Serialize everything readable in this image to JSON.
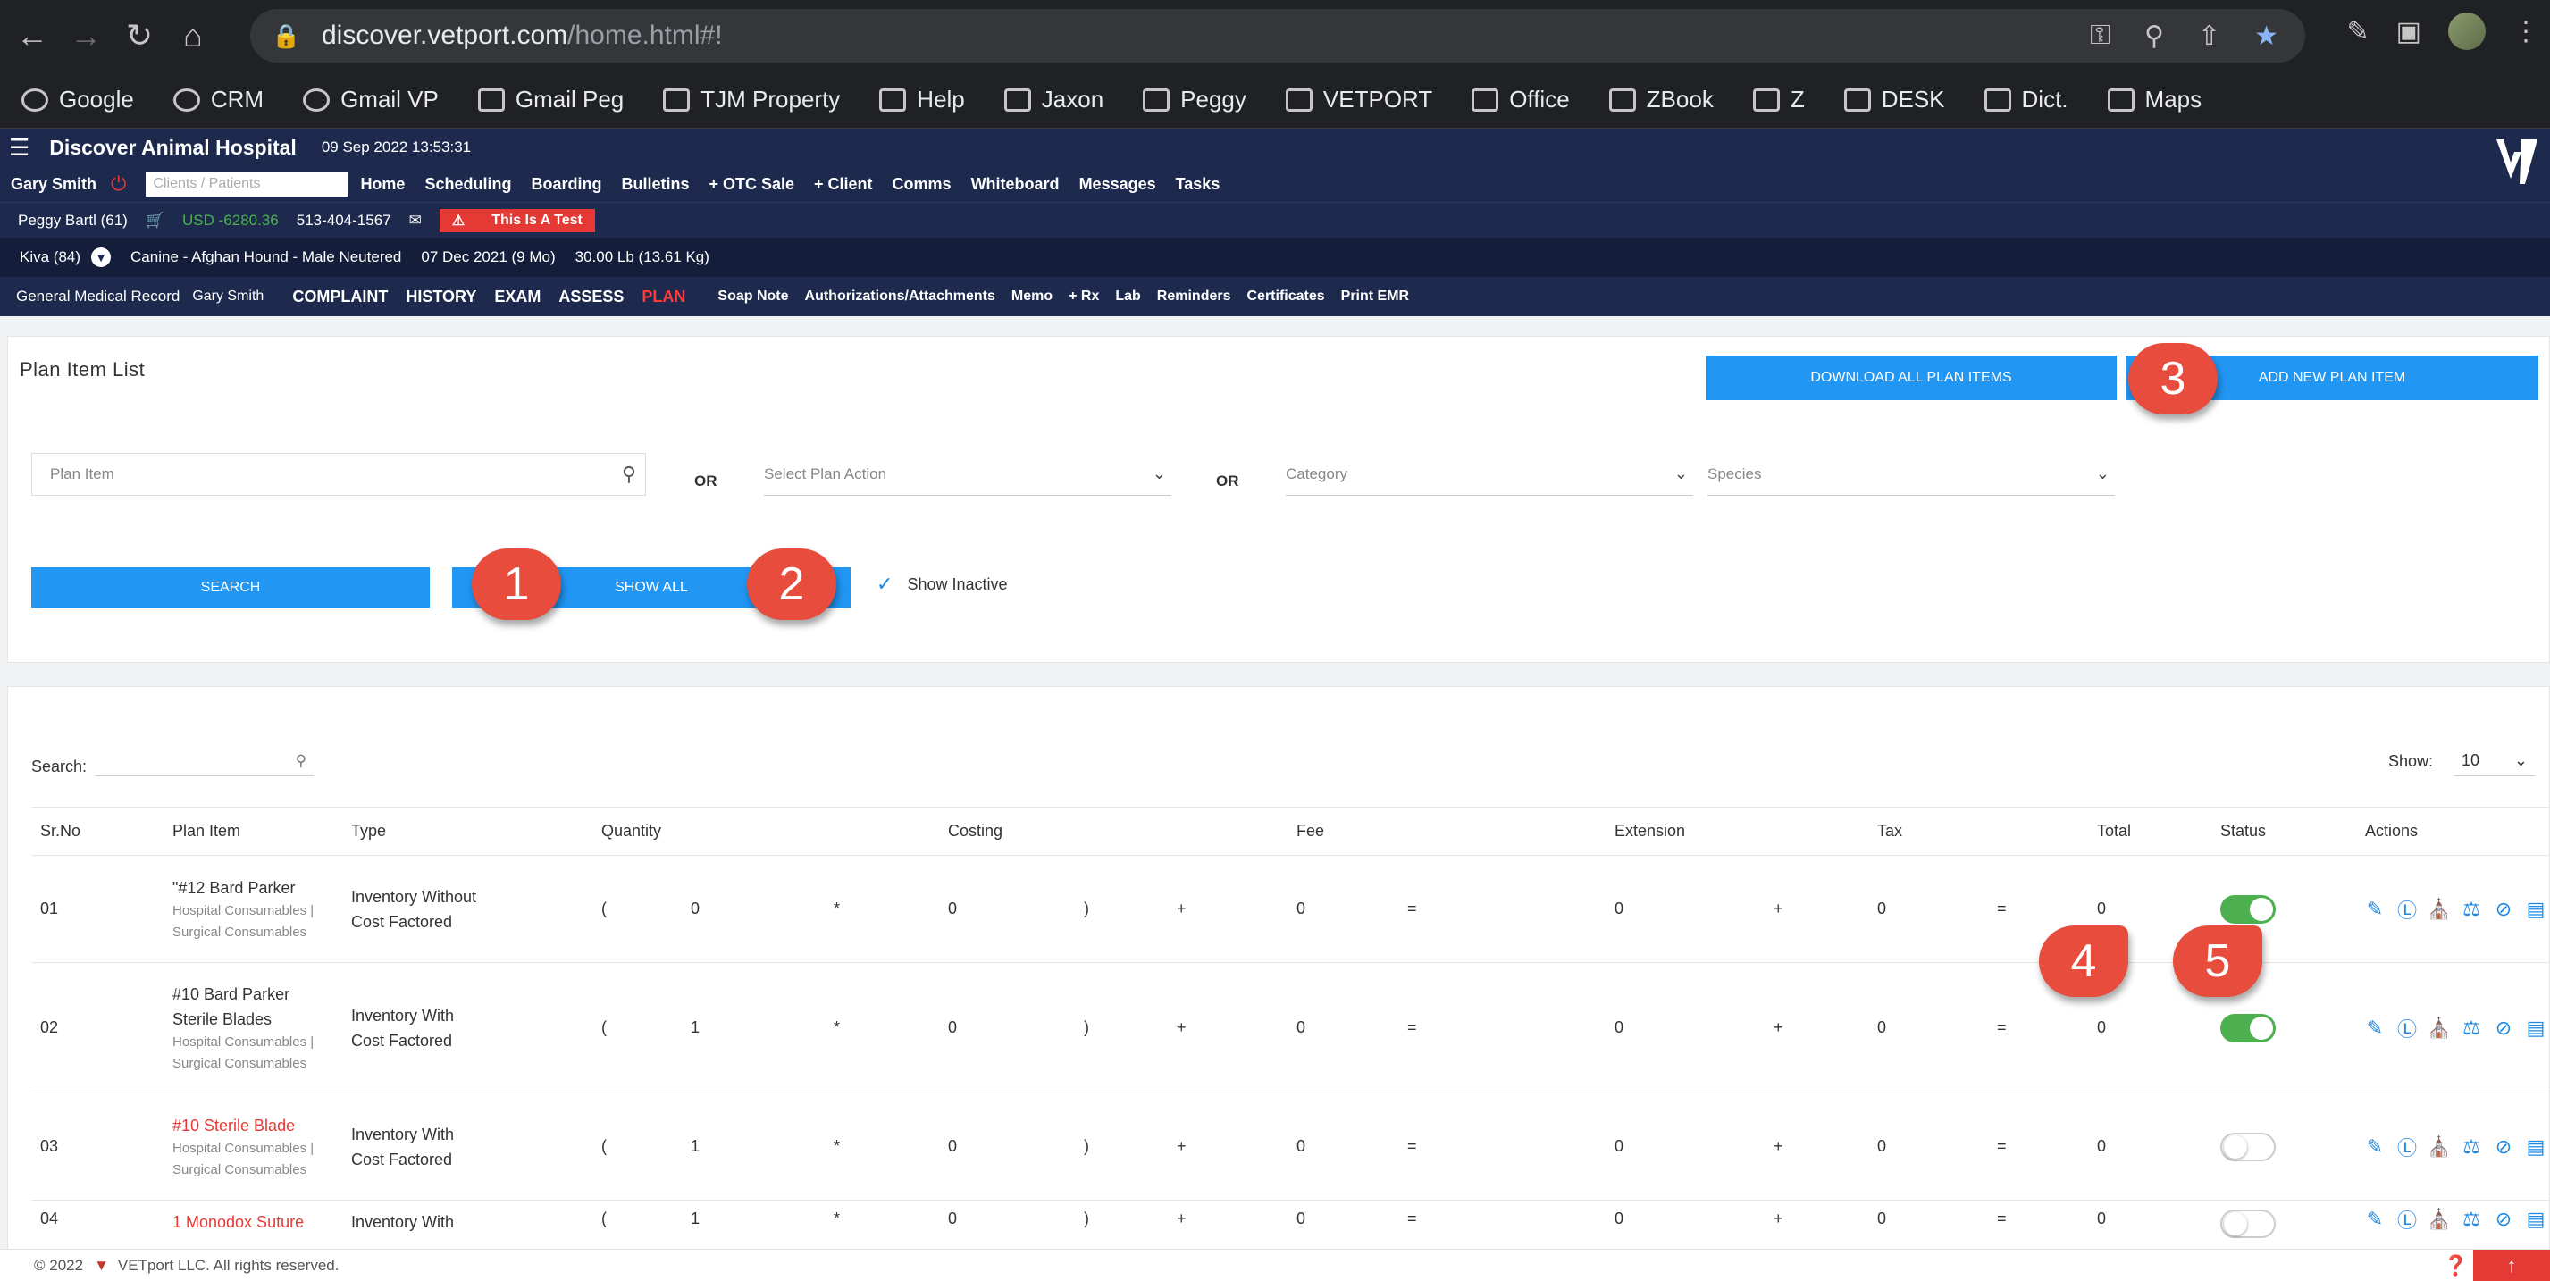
{
  "browser": {
    "url_host": "discover.vetport.com",
    "url_path": "/home.html#!",
    "bookmarks": [
      "Google",
      "CRM",
      "Gmail VP",
      "Gmail Peg",
      "TJM Property",
      "Help",
      "Jaxon",
      "Peggy",
      "VETPORT",
      "Office",
      "ZBook",
      "Z",
      "DESK",
      "Dict.",
      "Maps"
    ]
  },
  "header": {
    "clinic": "Discover Animal Hospital",
    "datetime": "09 Sep 2022 13:53:31",
    "user": "Gary Smith",
    "client_search_placeholder": "Clients / Patients",
    "nav": [
      "Home",
      "Scheduling",
      "Boarding",
      "Bulletins",
      "+ OTC Sale",
      "+ Client",
      "Comms",
      "Whiteboard",
      "Messages",
      "Tasks"
    ]
  },
  "client": {
    "name": "Peggy Bartl (61)",
    "balance": "USD -6280.36",
    "phone": "513-404-1567",
    "alert": "This Is A Test"
  },
  "patient": {
    "name": "Kiva (84)",
    "breed": "Canine - Afghan Hound - Male Neutered",
    "dob": "07 Dec 2021 (9 Mo)",
    "weight": "30.00 Lb (13.61 Kg)"
  },
  "emr": {
    "label": "General Medical Record",
    "doctor": "Gary Smith",
    "tabs": [
      "COMPLAINT",
      "HISTORY",
      "EXAM",
      "ASSESS",
      "PLAN"
    ],
    "links": [
      "Soap Note",
      "Authorizations/Attachments",
      "Memo",
      "+ Rx",
      "Lab",
      "Reminders",
      "Certificates",
      "Print EMR"
    ]
  },
  "plan": {
    "title": "Plan Item List",
    "download_label": "DOWNLOAD ALL PLAN ITEMS",
    "add_label": "ADD NEW PLAN ITEM",
    "plan_item_placeholder": "Plan Item",
    "or": "OR",
    "action_placeholder": "Select Plan Action",
    "category_placeholder": "Category",
    "species_placeholder": "Species",
    "search_label": "SEARCH",
    "showall_label": "SHOW ALL",
    "show_inactive": "Show Inactive"
  },
  "table": {
    "search_label": "Search:",
    "show_label": "Show:",
    "show_value": "10",
    "columns": [
      "Sr.No",
      "Plan Item",
      "Type",
      "Quantity",
      "Costing",
      "Fee",
      "Extension",
      "Tax",
      "Total",
      "Status",
      "Actions"
    ],
    "rows": [
      {
        "sr": "01",
        "name": "\"#12 Bard Parker",
        "cat1": "Hospital Consumables |",
        "cat2": "Surgical Consumables",
        "type1": "Inventory Without",
        "type2": "Cost Factored",
        "qty": "0",
        "cost": "0",
        "fee": "0",
        "ext": "0",
        "tax": "0",
        "total": "0"
      },
      {
        "sr": "02",
        "name": "#10 Bard Parker",
        "name2": "Sterile Blades",
        "cat1": "Hospital Consumables |",
        "cat2": "Surgical Consumables",
        "type1": "Inventory With",
        "type2": "Cost Factored",
        "qty": "1",
        "cost": "0",
        "fee": "0",
        "ext": "0",
        "tax": "0",
        "total": "0"
      },
      {
        "sr": "03",
        "name": "#10 Sterile Blade",
        "cat1": "Hospital Consumables |",
        "cat2": "Surgical Consumables",
        "type1": "Inventory With",
        "type2": "Cost Factored",
        "qty": "1",
        "cost": "0",
        "fee": "0",
        "ext": "0",
        "tax": "0",
        "total": "0"
      },
      {
        "sr": "04",
        "name": "1 Monodox Suture",
        "type1": "Inventory With",
        "qty": "1",
        "cost": "0",
        "fee": "0",
        "ext": "0",
        "tax": "0",
        "total": "0"
      }
    ]
  },
  "annotations": [
    "1",
    "2",
    "3",
    "4",
    "5"
  ],
  "footer": {
    "copy": "© 2022",
    "company": "VETport LLC. All rights reserved."
  }
}
